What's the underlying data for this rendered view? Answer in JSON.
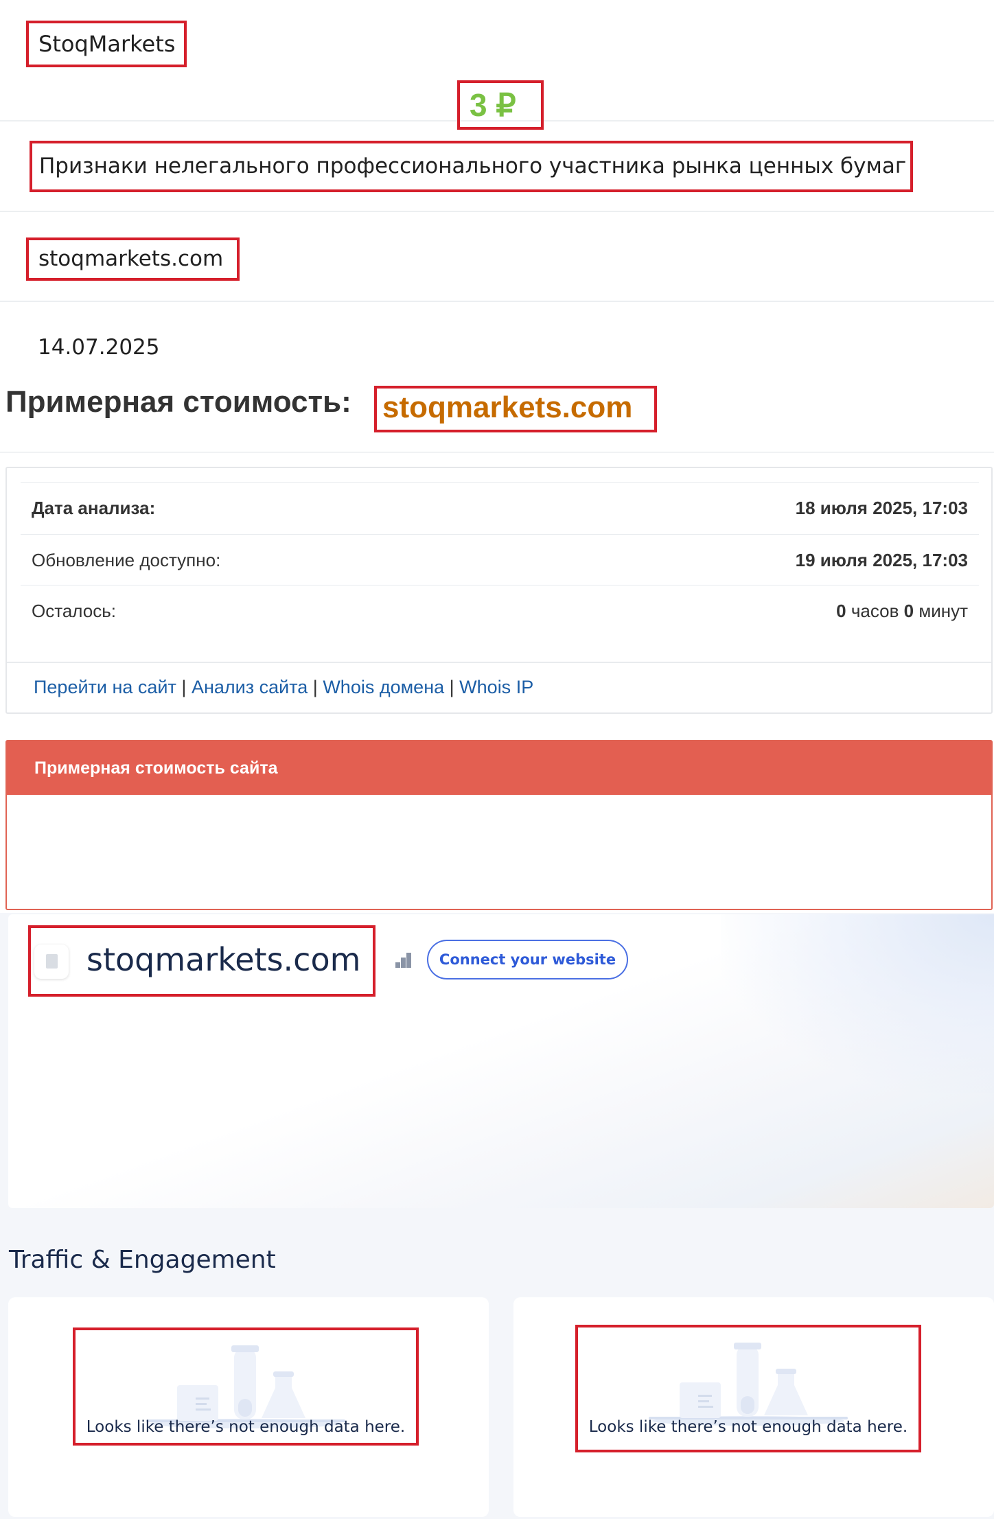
{
  "page": {
    "brand_name": "StoqMarkets",
    "description": "Признаки нелегального профессионального участника рынка ценных бумаг",
    "domain": "stoqmarkets.com",
    "date": "14.07.2025"
  },
  "valuation": {
    "heading_label": "Примерная стоимость:",
    "heading_domain": "stoqmarkets.com",
    "rows": [
      {
        "label": "Дата анализа:",
        "value": "18 июля 2025, 17:03"
      },
      {
        "label": "Обновление доступно:",
        "value": "19 июля 2025, 17:03"
      }
    ],
    "remaining": {
      "label": "Осталось:",
      "hours_value": "0",
      "hours_unit": "часов",
      "minutes_value": "0",
      "minutes_unit": "минут"
    },
    "links": [
      "Перейти на сайт",
      "Анализ сайта",
      "Whois домена",
      "Whois IP"
    ],
    "separator": "|",
    "estimate_header": "Примерная стоимость сайта",
    "estimate_value": "3 ₽"
  },
  "widget": {
    "domain": "stoqmarkets.com",
    "connect_button": "Connect your website",
    "section_title": "Traffic & Engagement",
    "cards": [
      {
        "message": "Looks like there’s not enough data here."
      },
      {
        "message": "Looks like there’s not enough data here."
      }
    ]
  },
  "icons": {
    "favicon": "page-icon",
    "rank": "bar-chart-icon",
    "empty_state": "lab-flasks-illustration"
  },
  "colors": {
    "highlight_box": "#d51f2b",
    "domain_orange": "#c66b00",
    "estimate_header_bg": "#e35f51",
    "estimate_value": "#7ac143",
    "link_blue": "#1c5ea6",
    "connect_blue": "#2e5ad8"
  }
}
